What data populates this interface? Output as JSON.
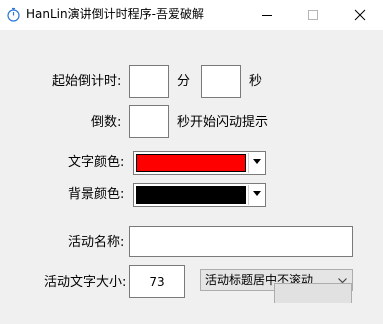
{
  "window": {
    "title": "HanLin演讲倒计时程序-吾爱破解"
  },
  "form": {
    "countdown_label": "起始倒计时:",
    "minutes_value": "",
    "minutes_unit": "分",
    "seconds_value": "",
    "seconds_unit": "秒",
    "count_label": "倒数:",
    "count_value": "",
    "count_suffix": "秒开始闪动提示",
    "text_color_label": "文字颜色:",
    "text_color": "#ff0000",
    "bg_color_label": "背景颜色:",
    "bg_color": "#000000",
    "activity_name_label": "活动名称:",
    "activity_name_value": "",
    "font_size_label": "活动文字大小:",
    "font_size_value": "73",
    "title_mode_selected": "活动标题居中不滚动"
  },
  "icons": {
    "app": "stopwatch-icon",
    "minimize": "minimize-icon",
    "maximize": "maximize-icon",
    "close": "close-icon",
    "dropdown": "chevron-down-icon"
  }
}
